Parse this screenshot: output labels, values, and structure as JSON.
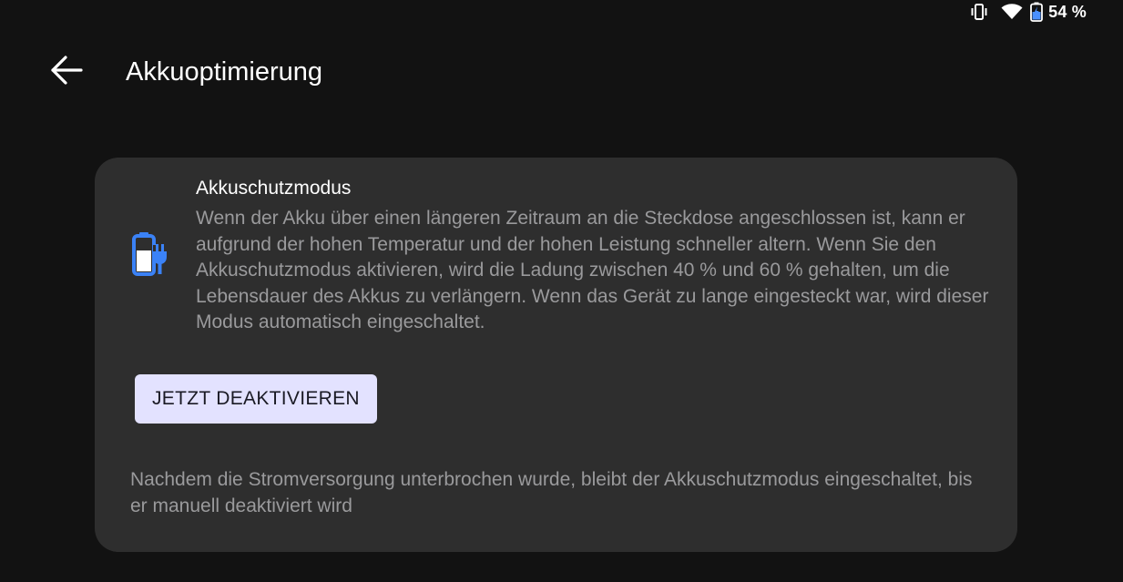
{
  "status_bar": {
    "battery_percent": "54 %",
    "icons": [
      "vibrate-icon",
      "wifi-icon",
      "battery-charging-icon"
    ]
  },
  "app_bar": {
    "back_icon": "arrow-left-icon",
    "title": "Akkuoptimierung"
  },
  "card": {
    "icon": "battery-plug-icon",
    "accent_color": "#3b82f6",
    "title": "Akkuschutzmodus",
    "description": "Wenn der Akku über einen längeren Zeitraum an die Steckdose angeschlossen ist, kann er aufgrund der hohen Temperatur und der hohen Leistung schneller altern. Wenn Sie den Akkuschutzmodus aktivieren, wird die Ladung zwischen 40 % und 60 % gehalten, um die Lebensdauer des Akkus zu verlängern. Wenn das Gerät zu lange eingesteckt war, wird dieser Modus automatisch eingeschaltet.",
    "button_label": "JETZT DEAKTIVIEREN",
    "footer": "Nachdem die Stromversorgung unterbrochen wurde, bleibt der Akkuschutzmodus eingeschaltet, bis er manuell deaktiviert wird"
  }
}
